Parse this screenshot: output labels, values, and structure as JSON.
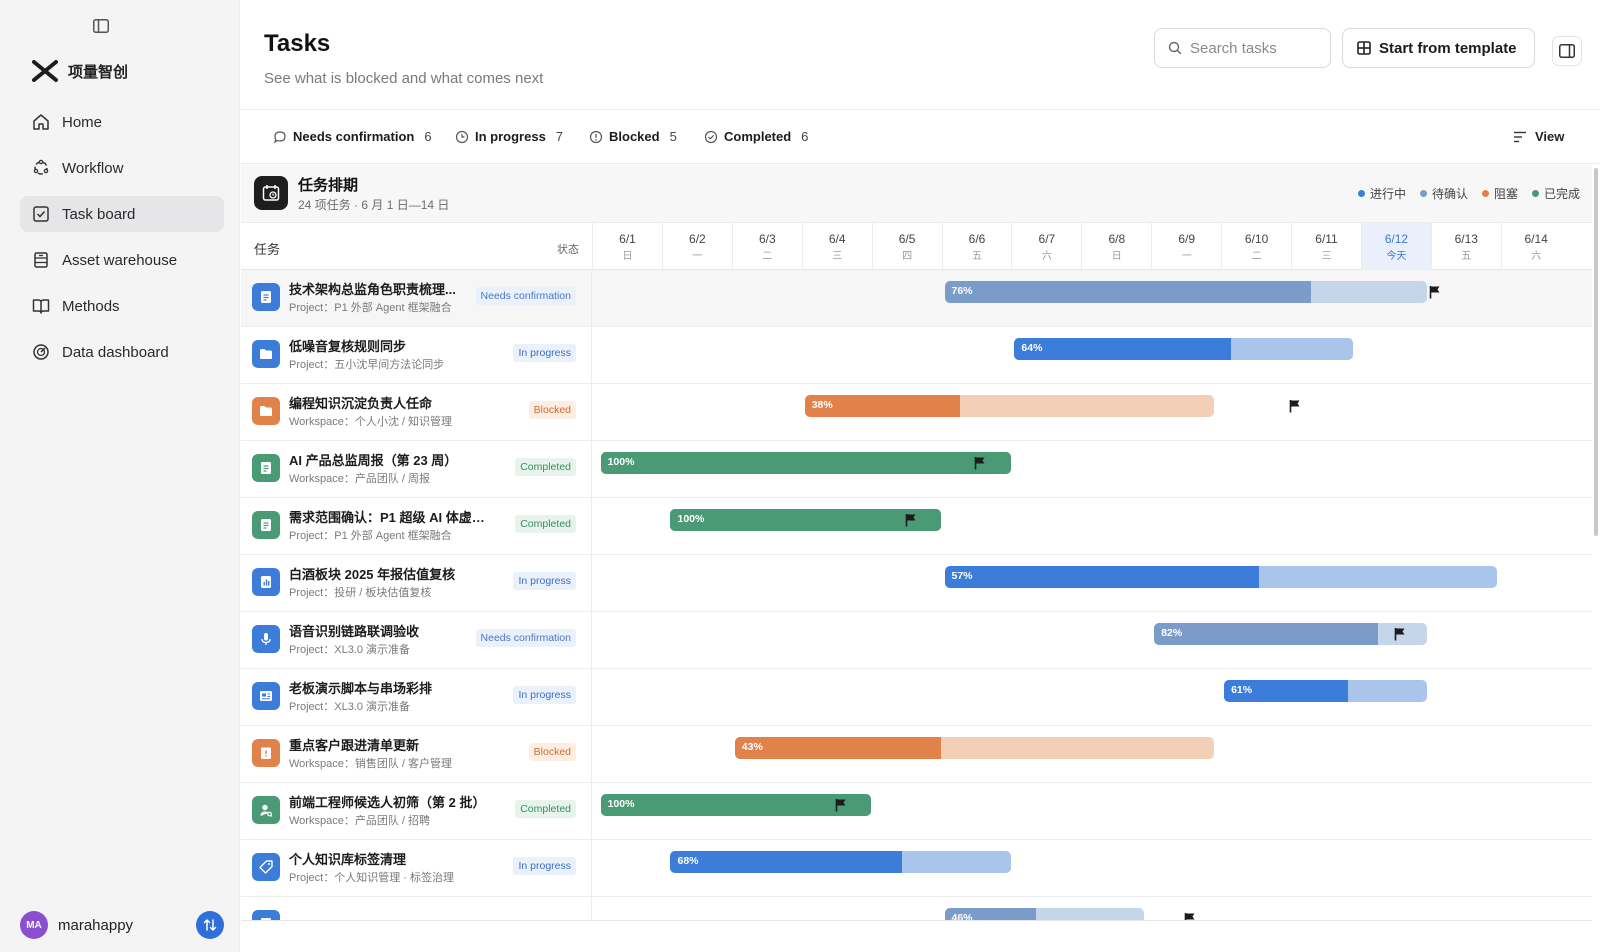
{
  "sidebar": {
    "brand": "项量智创",
    "nav": [
      {
        "label": "Home",
        "icon": "home-icon",
        "active": false
      },
      {
        "label": "Workflow",
        "icon": "workflow-icon",
        "active": false
      },
      {
        "label": "Task board",
        "icon": "task-board-icon",
        "active": true
      },
      {
        "label": "Asset warehouse",
        "icon": "asset-warehouse-icon",
        "active": false
      },
      {
        "label": "Methods",
        "icon": "book-icon",
        "active": false
      },
      {
        "label": "Data dashboard",
        "icon": "gauge-icon",
        "active": false
      }
    ],
    "user": {
      "initials": "MA",
      "name": "marahappy"
    }
  },
  "header": {
    "title": "Tasks",
    "subtitle": "See what is blocked and what comes next",
    "search_placeholder": "Search tasks",
    "template_button": "Start from template"
  },
  "filters": [
    {
      "label": "Needs confirmation",
      "count": "6",
      "icon": "chat-bubble-icon"
    },
    {
      "label": "In progress",
      "count": "7",
      "icon": "clock-icon"
    },
    {
      "label": "Blocked",
      "count": "5",
      "icon": "alert-circle-icon"
    },
    {
      "label": "Completed",
      "count": "6",
      "icon": "check-circle-icon"
    }
  ],
  "view_button": "View",
  "board": {
    "title": "任务排期",
    "subtitle": "24 项任务 · 6 月 1 日—14 日",
    "legend": [
      {
        "label": "进行中",
        "color": "#3b7dd8"
      },
      {
        "label": "待确认",
        "color": "#7b9cc9"
      },
      {
        "label": "阻塞",
        "color": "#e0824a"
      },
      {
        "label": "已完成",
        "color": "#4a9a76"
      }
    ],
    "col_task": "任务",
    "col_status": "状态",
    "days": [
      {
        "date": "6/1",
        "weekday": "日"
      },
      {
        "date": "6/2",
        "weekday": "一"
      },
      {
        "date": "6/3",
        "weekday": "二"
      },
      {
        "date": "6/4",
        "weekday": "三"
      },
      {
        "date": "6/5",
        "weekday": "四"
      },
      {
        "date": "6/6",
        "weekday": "五"
      },
      {
        "date": "6/7",
        "weekday": "六"
      },
      {
        "date": "6/8",
        "weekday": "日"
      },
      {
        "date": "6/9",
        "weekday": "一"
      },
      {
        "date": "6/10",
        "weekday": "二"
      },
      {
        "date": "6/11",
        "weekday": "三"
      },
      {
        "date": "6/12",
        "weekday": "今天",
        "today": true
      },
      {
        "date": "6/13",
        "weekday": "五"
      },
      {
        "date": "6/14",
        "weekday": "六"
      }
    ],
    "status_styles": {
      "Needs confirmation": {
        "bg": "#eaf1fb",
        "fg": "#4a78c2",
        "fill": "#7b9cc9",
        "track": "#c5d5ea"
      },
      "In progress": {
        "bg": "#eaf1fb",
        "fg": "#3b6fc7",
        "fill": "#3b7dd8",
        "track": "#a9c5ec"
      },
      "Blocked": {
        "bg": "#fdeee4",
        "fg": "#d26a32",
        "fill": "#e0824a",
        "track": "#f3cfb8"
      },
      "Completed": {
        "bg": "#e6f4ec",
        "fg": "#3e8a64",
        "fill": "#4a9a76",
        "track": "#4a9a76"
      }
    },
    "tasks": [
      {
        "name": "技术架构总监角色职责梳理...",
        "path": "Project：P1 外部 Agent 框架融合",
        "status": "Needs confirmation",
        "icon": "doc-icon",
        "icon_color": "#3b7dd8",
        "start": 5,
        "end": 11.9,
        "pct": 76,
        "pct_label": "76%",
        "flag": 12,
        "highlight": true
      },
      {
        "name": "低噪音复核规则同步",
        "path": "Project：五小沈早间方法论同步",
        "status": "In progress",
        "icon": "folder-icon",
        "icon_color": "#3b7dd8",
        "start": 6,
        "end": 10.85,
        "pct": 64,
        "pct_label": "64%",
        "flag": null
      },
      {
        "name": "编程知识沉淀负责人任命",
        "path": "Workspace：个人小沈 / 知识管理",
        "status": "Blocked",
        "icon": "folder-icon",
        "icon_color": "#e0824a",
        "start": 3,
        "end": 8.85,
        "pct": 38,
        "pct_label": "38%",
        "flag": 10
      },
      {
        "name": "AI 产品总监周报（第 23 周）",
        "path": "Workspace：产品团队 / 周报",
        "status": "Completed",
        "icon": "doc-icon",
        "icon_color": "#4a9a76",
        "start": 0.08,
        "end": 5.95,
        "pct": 100,
        "pct_label": "100%",
        "flag": 5.5
      },
      {
        "name": "需求范围确认：P1 超级 AI 体虚拟...",
        "path": "Project：P1 外部 Agent 框架融合",
        "status": "Completed",
        "icon": "doc-icon",
        "icon_color": "#4a9a76",
        "start": 1.08,
        "end": 4.95,
        "pct": 100,
        "pct_label": "100%",
        "flag": 4.5
      },
      {
        "name": "白酒板块 2025 年报估值复核",
        "path": "Project：投研 / 板块估值复核",
        "status": "In progress",
        "icon": "chart-icon",
        "icon_color": "#3b7dd8",
        "start": 5,
        "end": 12.9,
        "pct": 57,
        "pct_label": "57%",
        "flag": null
      },
      {
        "name": "语音识别链路联调验收",
        "path": "Project：XL3.0 演示准备",
        "status": "Needs confirmation",
        "icon": "mic-icon",
        "icon_color": "#3b7dd8",
        "start": 8,
        "end": 11.9,
        "pct": 82,
        "pct_label": "82%",
        "flag": 11.5
      },
      {
        "name": "老板演示脚本与串场彩排",
        "path": "Project：XL3.0 演示准备",
        "status": "In progress",
        "icon": "slides-icon",
        "icon_color": "#3b7dd8",
        "start": 9,
        "end": 11.9,
        "pct": 61,
        "pct_label": "61%",
        "flag": null
      },
      {
        "name": "重点客户跟进清单更新",
        "path": "Workspace：销售团队 / 客户管理",
        "status": "Blocked",
        "icon": "clipboard-icon",
        "icon_color": "#e0824a",
        "start": 2,
        "end": 8.85,
        "pct": 43,
        "pct_label": "43%",
        "flag": null
      },
      {
        "name": "前端工程师候选人初筛（第 2 批）",
        "path": "Workspace：产品团队 / 招聘",
        "status": "Completed",
        "icon": "person-icon",
        "icon_color": "#4a9a76",
        "start": 0.08,
        "end": 3.95,
        "pct": 100,
        "pct_label": "100%",
        "flag": 3.5
      },
      {
        "name": "个人知识库标签清理",
        "path": "Project：个人知识管理 · 标签治理",
        "status": "In progress",
        "icon": "tag-icon",
        "icon_color": "#3b7dd8",
        "start": 1.08,
        "end": 5.95,
        "pct": 68,
        "pct_label": "68%",
        "flag": null
      },
      {
        "name": "",
        "path": "",
        "status": "Needs confirmation",
        "icon": "doc-icon",
        "icon_color": "#3b7dd8",
        "start": 5,
        "end": 7.85,
        "pct": 46,
        "pct_label": "46%",
        "flag": 8.5,
        "hide_badge": true
      }
    ]
  }
}
